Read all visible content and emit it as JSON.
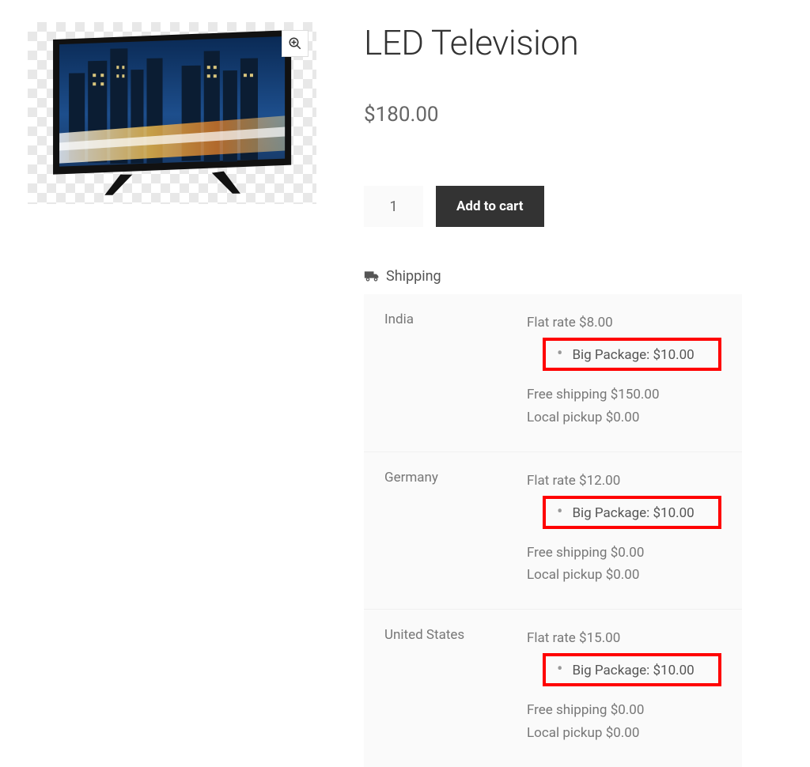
{
  "product": {
    "title": "LED Television",
    "currency": "$",
    "price": "180.00",
    "quantity": "1",
    "addToCartLabel": "Add to cart"
  },
  "shipping": {
    "label": "Shipping",
    "rows": [
      {
        "country": "India",
        "flat_label": "Flat rate",
        "flat_price": "$8.00",
        "extra_label": "Big Package:",
        "extra_price": "$10.00",
        "free_label": "Free shipping",
        "free_price": "$150.00",
        "pickup_label": "Local pickup",
        "pickup_price": "$0.00"
      },
      {
        "country": "Germany",
        "flat_label": "Flat rate",
        "flat_price": "$12.00",
        "extra_label": "Big Package:",
        "extra_price": "$10.00",
        "free_label": "Free shipping",
        "free_price": "$0.00",
        "pickup_label": "Local pickup",
        "pickup_price": "$0.00"
      },
      {
        "country": "United States",
        "flat_label": "Flat rate",
        "flat_price": "$15.00",
        "extra_label": "Big Package:",
        "extra_price": "$10.00",
        "free_label": "Free shipping",
        "free_price": "$0.00",
        "pickup_label": "Local pickup",
        "pickup_price": "$0.00"
      }
    ]
  }
}
